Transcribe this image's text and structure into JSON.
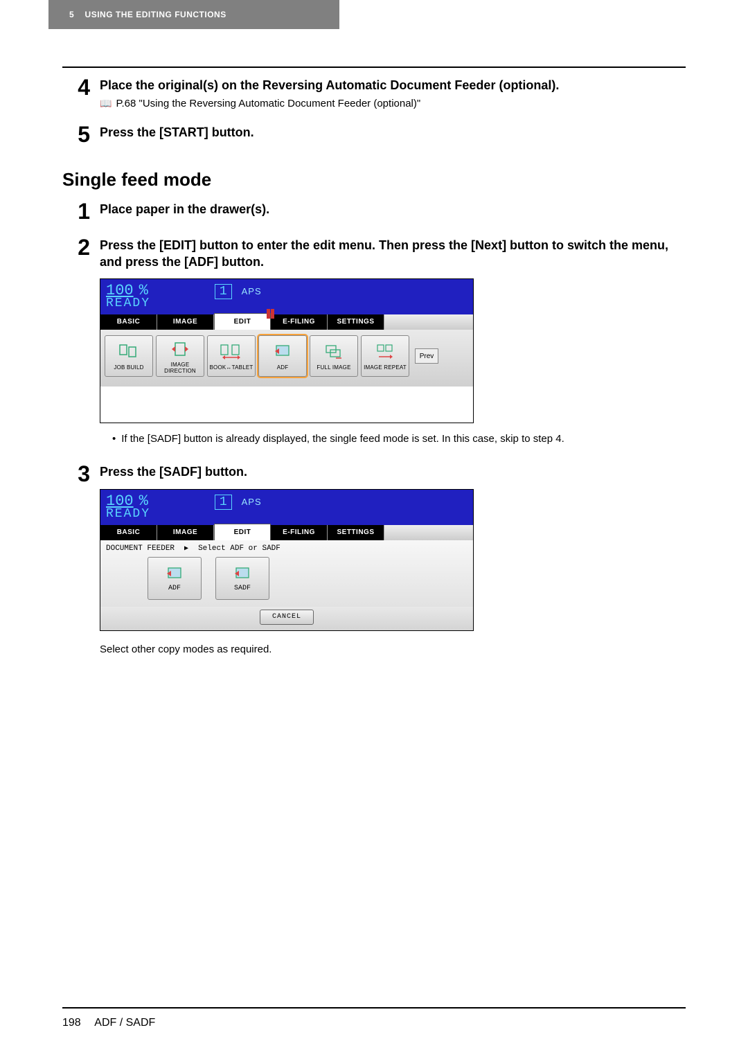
{
  "header": {
    "chapter_num": "5",
    "chapter_title": "USING THE EDITING FUNCTIONS"
  },
  "top_steps": {
    "s4": {
      "num": "4",
      "title": "Place the original(s) on the Reversing Automatic Document Feeder (optional).",
      "reference": "P.68 \"Using the Reversing Automatic Document Feeder (optional)\""
    },
    "s5": {
      "num": "5",
      "title": "Press the [START] button."
    }
  },
  "section_title": "Single feed mode",
  "steps": {
    "s1": {
      "num": "1",
      "title": "Place paper in the drawer(s)."
    },
    "s2": {
      "num": "2",
      "title": "Press the [EDIT] button to enter the edit menu. Then press the [Next] button to switch the menu, and press the [ADF] button.",
      "note": "If the [SADF] button is already displayed, the single feed mode is set. In this case, skip to step 4."
    },
    "s3": {
      "num": "3",
      "title": "Press the [SADF] button.",
      "post_note": "Select other copy modes as required."
    }
  },
  "panel1": {
    "zoom": "100",
    "pct": "%",
    "qty": "1",
    "mode_label": "APS",
    "ready": "READY",
    "tabs": [
      "BASIC",
      "IMAGE",
      "EDIT",
      "E-FILING",
      "SETTINGS"
    ],
    "tool_buttons": [
      "JOB BUILD",
      "IMAGE DIRECTION",
      "BOOK↔TABLET",
      "ADF",
      "FULL IMAGE",
      "IMAGE REPEAT"
    ],
    "prev": "Prev"
  },
  "panel2": {
    "zoom": "100",
    "pct": "%",
    "qty": "1",
    "mode_label": "APS",
    "ready": "READY",
    "tabs": [
      "BASIC",
      "IMAGE",
      "EDIT",
      "E-FILING",
      "SETTINGS"
    ],
    "path_label": "DOCUMENT FEEDER",
    "path_action": "Select ADF or SADF",
    "buttons": [
      "ADF",
      "SADF"
    ],
    "cancel": "CANCEL"
  },
  "footer": {
    "page": "198",
    "section": "ADF / SADF"
  }
}
